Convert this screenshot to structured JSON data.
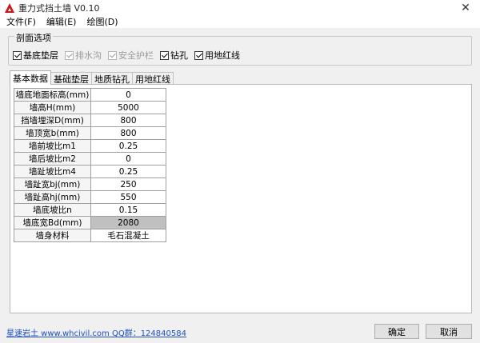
{
  "window": {
    "title": "重力式挡土墙 V0.10",
    "close_glyph": "✕"
  },
  "menu": [
    "文件(F)",
    "编辑(E)",
    "绘图(D)"
  ],
  "section_options": {
    "title": "剖面选项",
    "items": [
      {
        "label": "基底垫层",
        "checked": true,
        "enabled": true
      },
      {
        "label": "排水沟",
        "checked": true,
        "enabled": false
      },
      {
        "label": "安全护栏",
        "checked": true,
        "enabled": false
      },
      {
        "label": "钻孔",
        "checked": true,
        "enabled": true
      },
      {
        "label": "用地红线",
        "checked": true,
        "enabled": true
      }
    ]
  },
  "tabs": [
    {
      "label": "基本数据",
      "active": true
    },
    {
      "label": "基础垫层",
      "active": false
    },
    {
      "label": "地质钻孔",
      "active": false
    },
    {
      "label": "用地红线",
      "active": false
    }
  ],
  "basic_data_rows": [
    {
      "label": "墙底地面标高(mm)",
      "value": "0"
    },
    {
      "label": "墙高H(mm)",
      "value": "5000"
    },
    {
      "label": "挡墙埋深D(mm)",
      "value": "800"
    },
    {
      "label": "墙顶宽b(mm)",
      "value": "800"
    },
    {
      "label": "墙前坡比m1",
      "value": "0.25"
    },
    {
      "label": "墙后坡比m2",
      "value": "0"
    },
    {
      "label": "墙趾坡比m4",
      "value": "0.25"
    },
    {
      "label": "墙趾宽bj(mm)",
      "value": "250"
    },
    {
      "label": "墙趾高hj(mm)",
      "value": "550"
    },
    {
      "label": "墙底坡比n",
      "value": "0.15"
    },
    {
      "label": "墙底宽Bd(mm)",
      "value": "2080"
    },
    {
      "label": "墙身材料",
      "value": "毛石混凝土"
    }
  ],
  "footer": {
    "link_text": "星速岩土 www.whcivil.com QQ群：124840584",
    "ok_label": "确定",
    "cancel_label": "取消"
  },
  "colors": {
    "accent": "#c8161d",
    "link": "#1f4fbf",
    "computed_cell": "#c0c0c0",
    "dialog_bg": "#f0f0f0"
  }
}
